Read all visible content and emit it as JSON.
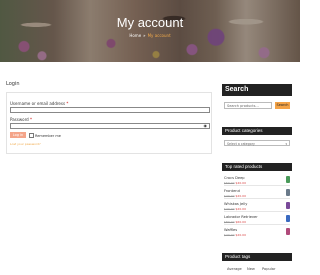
{
  "hero": {
    "title": "My account"
  },
  "breadcrumb": {
    "home": "Home",
    "separator": "»",
    "current": "My account"
  },
  "login": {
    "title": "Login",
    "username_label": "Username or email address",
    "password_label": "Password",
    "required_mark": "*",
    "button_label": "Log in",
    "remember_label": "Remember me",
    "lost_password": "Lost your password?"
  },
  "sidebar": {
    "search": {
      "title": "Search",
      "placeholder": "Search products…",
      "button": "Search"
    },
    "categories": {
      "title": "Product categories",
      "select_placeholder": "Select a category"
    },
    "top_rated": {
      "title": "Top rated products",
      "items": [
        {
          "name": "Crocs Deep",
          "old_price": "$60.00",
          "price": "$40.00",
          "thumb_color": "#4a9a5a"
        },
        {
          "name": "Frontend",
          "old_price": "$40.00",
          "price": "$20.00",
          "thumb_color": "#6a7a8a"
        },
        {
          "name": "Whiskas Jelly",
          "old_price": "$40.00",
          "price": "$20.00",
          "thumb_color": "#7a4a9a"
        },
        {
          "name": "Labrador Retriever",
          "old_price": "$80.00",
          "price": "$60.00",
          "thumb_color": "#3a6ac0"
        },
        {
          "name": "Waffles",
          "old_price": "$40.00",
          "price": "$20.00",
          "thumb_color": "#b04a7a"
        }
      ]
    },
    "tags": {
      "title": "Product tags",
      "items": [
        "Average",
        "New",
        "Popular"
      ]
    }
  },
  "colors": {
    "accent": "#f4a347",
    "button_soft": "#f4a58a",
    "sale": "#d94545",
    "widget_header": "#222222"
  }
}
